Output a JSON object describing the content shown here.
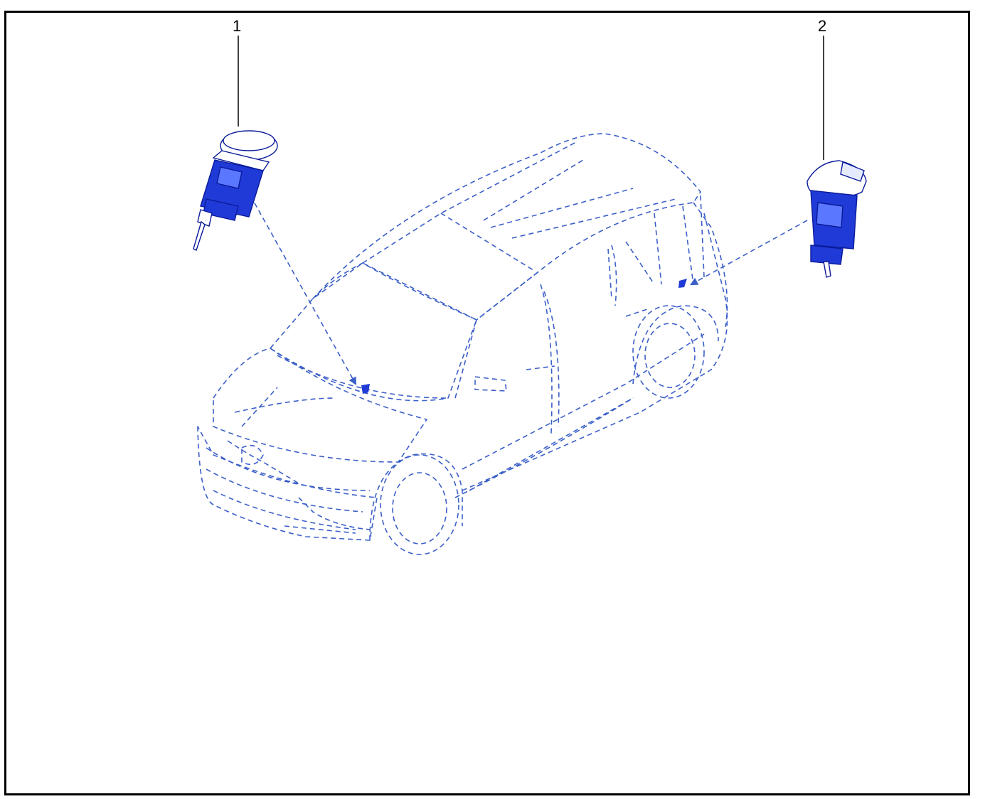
{
  "callouts": [
    {
      "number": "1",
      "part": "sensor-left"
    },
    {
      "number": "2",
      "part": "sensor-right"
    }
  ],
  "colors": {
    "line": "#3b5fc8",
    "part_fill": "#1f3ad6",
    "part_stroke": "#0a1a9a",
    "frame": "#000000"
  }
}
